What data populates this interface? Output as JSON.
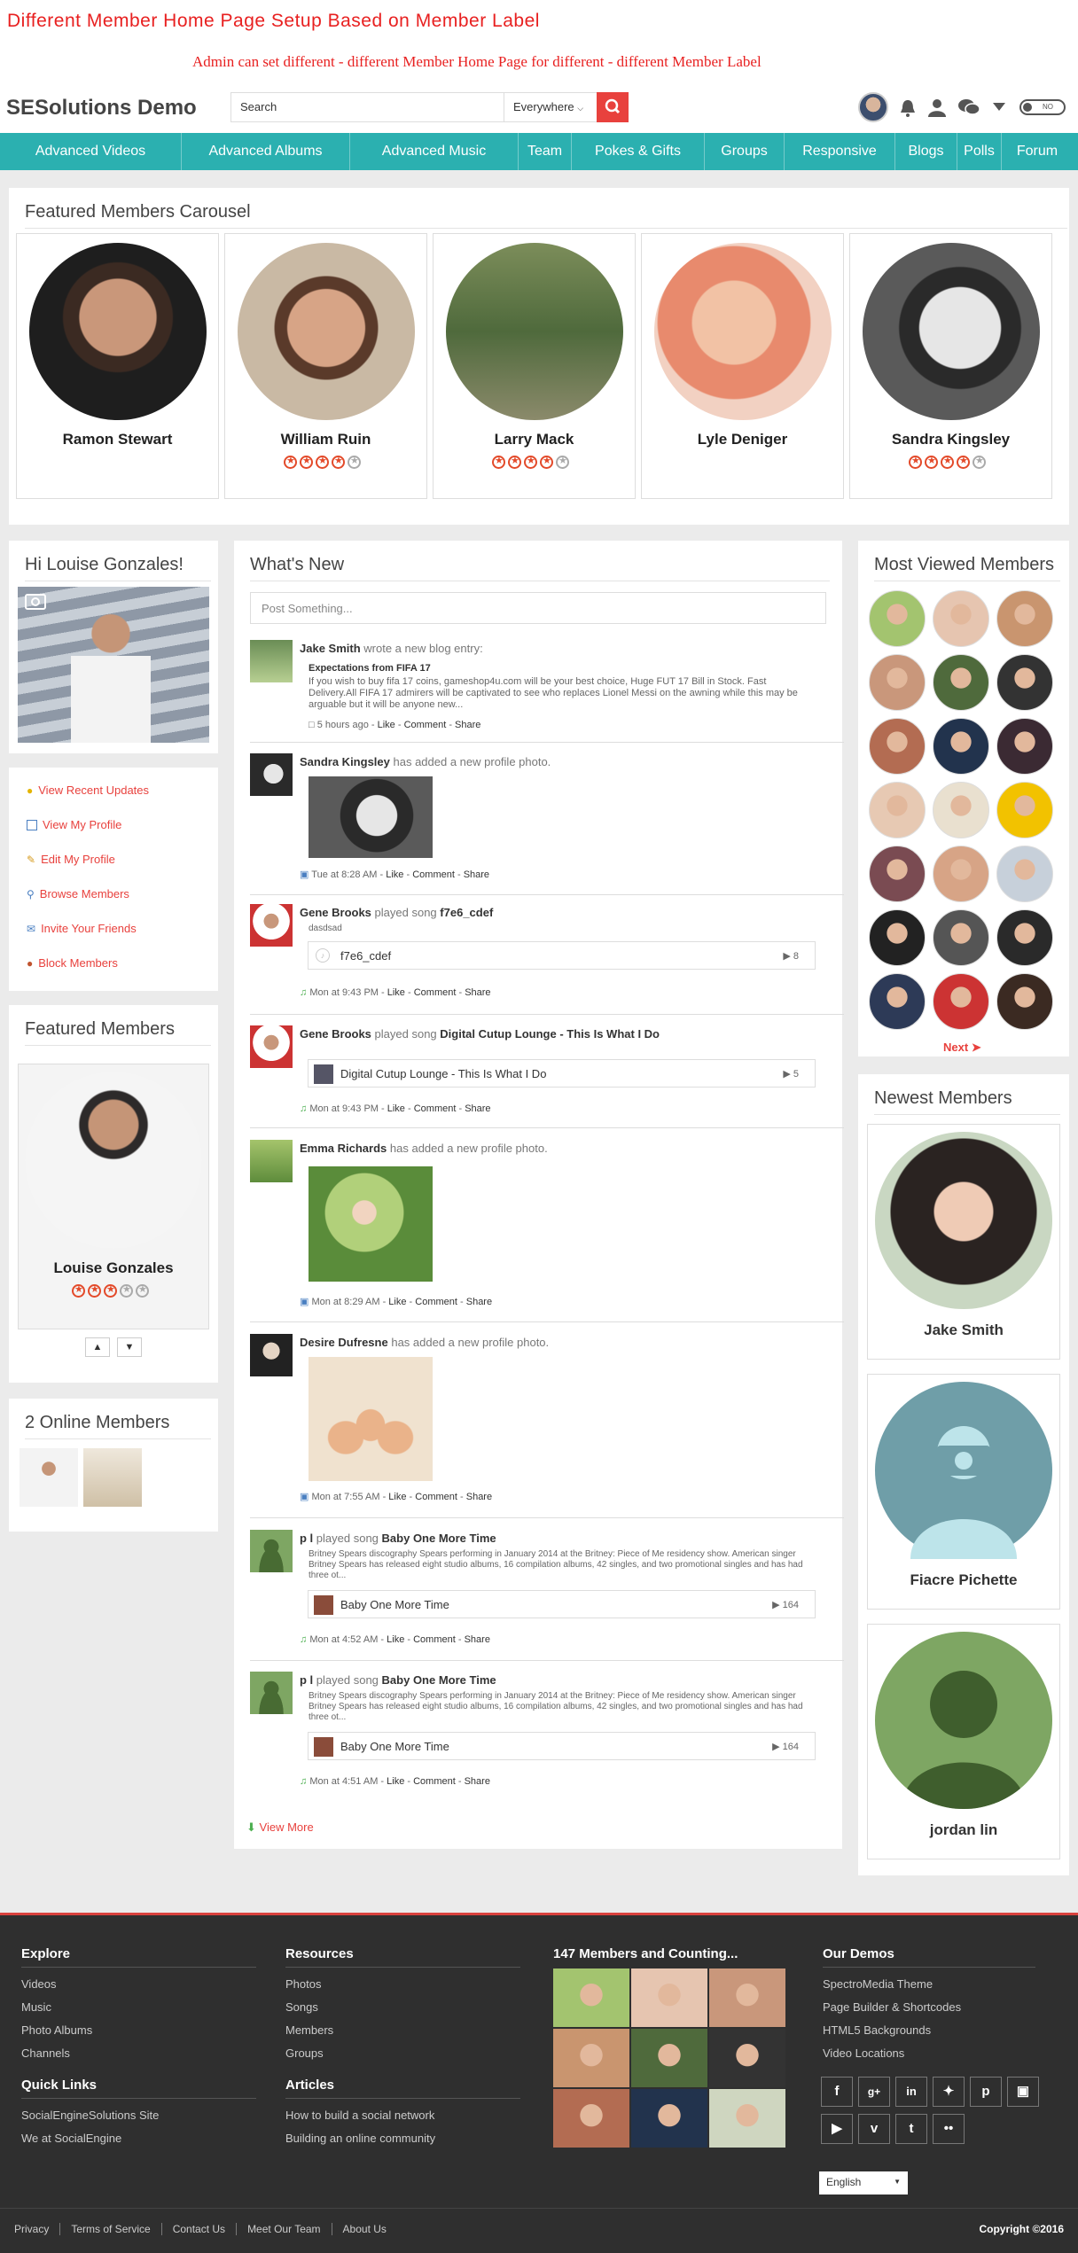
{
  "promo": {
    "title": "Different Member Home Page Setup Based on Member Label",
    "subtitle": "Admin can set different - different Member Home Page for different  - different  Member Label"
  },
  "header": {
    "site_name": "SESolutions Demo",
    "search_placeholder": "Search",
    "scope": "Everywhere",
    "toggle": "NO"
  },
  "nav": [
    "Advanced Videos",
    "Advanced Albums",
    "Advanced Music",
    "Team",
    "Pokes & Gifts",
    "Groups",
    "Responsive",
    "Blogs",
    "Polls",
    "Forum"
  ],
  "carousel": {
    "title": "Featured Members Carousel",
    "members": [
      {
        "name": "Ramon Stewart",
        "rating": 0
      },
      {
        "name": "William Ruin",
        "rating": 4
      },
      {
        "name": "Larry Mack",
        "rating": 4
      },
      {
        "name": "Lyle Deniger",
        "rating": 0
      },
      {
        "name": "Sandra Kingsley",
        "rating": 4
      }
    ]
  },
  "greeting": {
    "title": "Hi Louise Gonzales!"
  },
  "quick_links": [
    "View Recent Updates",
    "View My Profile",
    "Edit My Profile",
    "Browse Members",
    "Invite Your Friends",
    "Block Members"
  ],
  "featured": {
    "title": "Featured Members",
    "name": "Louise Gonzales",
    "rating": 3
  },
  "online": {
    "title": "2 Online Members"
  },
  "feed": {
    "title": "What's New",
    "post_placeholder": "Post Something...",
    "view_more": "View More",
    "entries": [
      {
        "user": "Jake Smith",
        "action": "wrote a new blog entry:",
        "blog_title": "Expectations from FIFA 17",
        "body": "If you wish to buy fifa 17 coins, gameshop4u.com will be your best choice, Huge FUT 17 Bill in Stock. Fast Delivery.All FIFA 17 admirers will be captivated to see who replaces Lionel Messi on the awning while this may be arguable but it will be anyone new...",
        "time": "5 hours ago"
      },
      {
        "user": "Sandra Kingsley",
        "action": "has added a new profile photo.",
        "time": "Tue at 8:28 AM"
      },
      {
        "user": "Gene Brooks",
        "action": "played song",
        "song": "f7e6_cdef",
        "note": "dasdsad",
        "plays": "8",
        "time": "Mon at 9:43 PM"
      },
      {
        "user": "Gene Brooks",
        "action": "played song",
        "song": "Digital Cutup Lounge - This Is What I Do",
        "plays": "5",
        "time": "Mon at 9:43 PM"
      },
      {
        "user": "Emma Richards",
        "action": "has added a new profile photo.",
        "time": "Mon at 8:29 AM"
      },
      {
        "user": "Desire Dufresne",
        "action": "has added a new profile photo.",
        "time": "Mon at 7:55 AM"
      },
      {
        "user": "p l",
        "action": "played song",
        "song": "Baby One More Time",
        "body": "Britney Spears discography Spears performing in January 2014 at the Britney: Piece of Me residency show. American singer Britney Spears has released eight studio albums, 16 compilation albums, 42 singles, and two promotional singles and has had three ot...",
        "plays": "164",
        "time": "Mon at 4:52 AM"
      },
      {
        "user": "p l",
        "action": "played song",
        "song": "Baby One More Time",
        "body": "Britney Spears discography Spears performing in January 2014 at the Britney: Piece of Me residency show. American singer Britney Spears has released eight studio albums, 16 compilation albums, 42 singles, and two promotional singles and has had three ot...",
        "plays": "164",
        "time": "Mon at 4:51 AM"
      }
    ],
    "like": "Like",
    "comment": "Comment",
    "share": "Share"
  },
  "most_viewed": {
    "title": "Most Viewed Members",
    "next": "Next"
  },
  "newest": {
    "title": "Newest Members",
    "members": [
      "Jake Smith",
      "Fiacre Pichette",
      "jordan lin"
    ]
  },
  "footer": {
    "explore": {
      "title": "Explore",
      "links": [
        "Videos",
        "Music",
        "Photo Albums",
        "Channels"
      ]
    },
    "resources": {
      "title": "Resources",
      "links": [
        "Photos",
        "Songs",
        "Members",
        "Groups"
      ]
    },
    "members": {
      "title": "147 Members and Counting..."
    },
    "demos": {
      "title": "Our Demos",
      "links": [
        "SpectroMedia Theme",
        "Page Builder & Shortcodes",
        "HTML5 Backgrounds",
        "Video Locations"
      ]
    },
    "quick": {
      "title": "Quick Links",
      "links": [
        "SocialEngineSolutions Site",
        "We at SocialEngine"
      ]
    },
    "articles": {
      "title": "Articles",
      "links": [
        "How to build a social network",
        "Building an online community"
      ]
    },
    "language": "English",
    "bottom_links": [
      "Privacy",
      "Terms of Service",
      "Contact Us",
      "Meet Our Team",
      "About Us"
    ],
    "copyright": "Copyright ©2016"
  },
  "colors": {
    "accent": "#e8413d",
    "nav": "#2bb0b0",
    "footer": "#2f2f2f"
  }
}
